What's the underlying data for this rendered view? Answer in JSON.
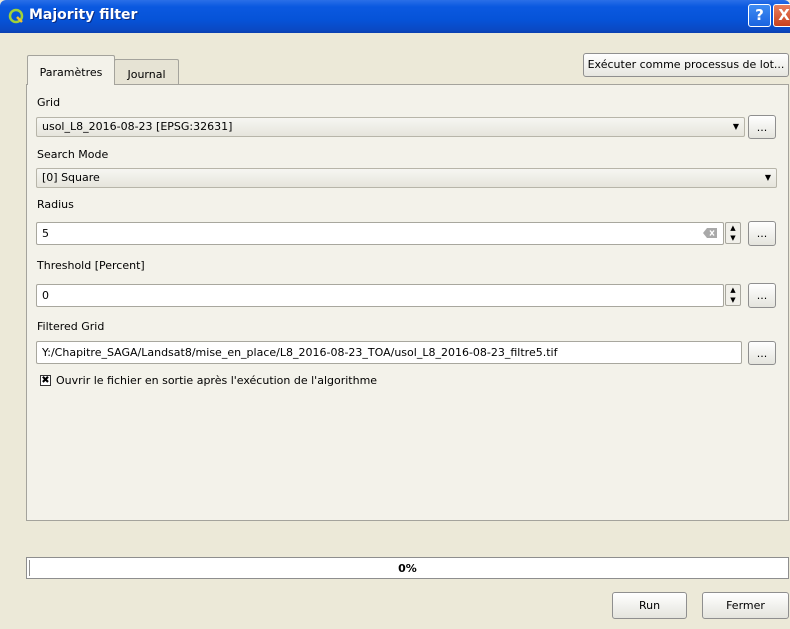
{
  "window": {
    "title": "Majority filter",
    "help_label": "?",
    "close_label": "X"
  },
  "tabs": [
    {
      "label": "Paramètres",
      "active": true
    },
    {
      "label": "Journal",
      "active": false
    }
  ],
  "batch_button_label": "Exécuter comme processus de lot...",
  "params": {
    "grid": {
      "label": "Grid",
      "value": "usol_L8_2016-08-23 [EPSG:32631]",
      "browse_label": "..."
    },
    "search_mode": {
      "label": "Search Mode",
      "value": "[0] Square"
    },
    "radius": {
      "label": "Radius",
      "value": "5",
      "browse_label": "..."
    },
    "threshold": {
      "label": "Threshold [Percent]",
      "value": "0",
      "browse_label": "..."
    },
    "filtered_grid": {
      "label": "Filtered Grid",
      "value": "Y:/Chapitre_SAGA/Landsat8/mise_en_place/L8_2016-08-23_TOA/usol_L8_2016-08-23_filtre5.tif",
      "browse_label": "..."
    },
    "open_output": {
      "label": "Ouvrir le fichier en sortie après l'exécution de l'algorithme",
      "checked": true
    }
  },
  "progress": {
    "value": 0,
    "text": "0%"
  },
  "buttons": {
    "run": "Run",
    "close": "Fermer"
  },
  "colors": {
    "titlebar": "#0653d8",
    "dialog_bg": "#ece9d8",
    "panel_bg": "#f3f2ea"
  },
  "icons": {
    "app": "qgis-icon",
    "help": "help-icon",
    "close": "close-icon"
  }
}
